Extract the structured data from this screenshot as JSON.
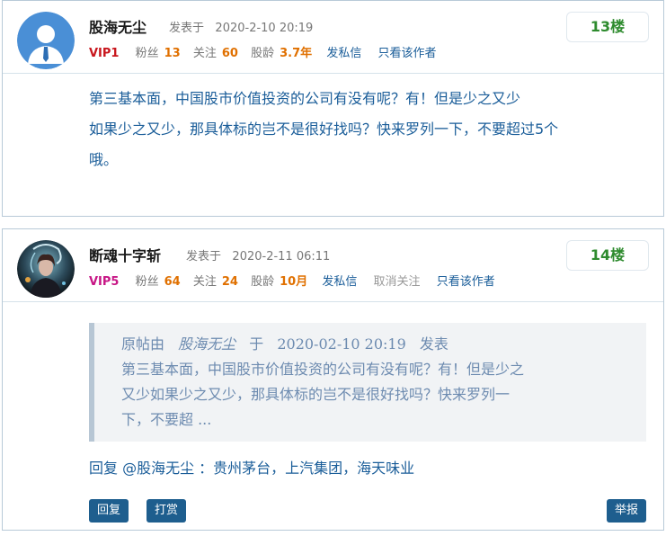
{
  "posts": [
    {
      "username": "股海无尘",
      "posted_prefix": "发表于",
      "posted_time": "2020-2-10 20:19",
      "vip": "VIP1",
      "fans_label": "粉丝",
      "fans": "13",
      "follow_label": "关注",
      "follow": "60",
      "age_label": "股龄",
      "age": "3.7年",
      "pm_link": "发私信",
      "only_author_link": "只看该作者",
      "floor": "13楼",
      "content_lines": [
        "第三基本面，中国股市价值投资的公司有没有呢？有！但是少之又少",
        "如果少之又少，那具体标的岂不是很好找吗？快来罗列一下，不要超过5个",
        "哦。"
      ]
    },
    {
      "username": "断魂十字斩",
      "posted_prefix": "发表于",
      "posted_time": "2020-2-11 06:11",
      "vip": "VIP5",
      "fans_label": "粉丝",
      "fans": "64",
      "follow_label": "关注",
      "follow": "24",
      "age_label": "股龄",
      "age": "10月",
      "pm_link": "发私信",
      "unfollow_link": "取消关注",
      "only_author_link": "只看该作者",
      "floor": "14楼",
      "quote": {
        "prefix": "原帖由",
        "author": "股海无尘",
        "mid": "于",
        "time": "2020-02-10 20:19",
        "suffix": "发表",
        "lines": [
          "第三基本面，中国股市价值投资的公司有没有呢？有！但是少之",
          "又少如果少之又少，那具体标的岂不是很好找吗？快来罗列一",
          "下，不要超 ..."
        ]
      },
      "reply_text": "回复 @股海无尘 ：贵州茅台，上汽集团，海天味业",
      "buttons": {
        "reply": "回复",
        "reward": "打赏",
        "report": "举报"
      }
    }
  ],
  "colors": {
    "link": "#1a5d99",
    "floor": "#2e8b2e",
    "button": "#1e5e8e",
    "vip1": "#c8161d",
    "vip5": "#c71585",
    "number": "#e07000"
  }
}
